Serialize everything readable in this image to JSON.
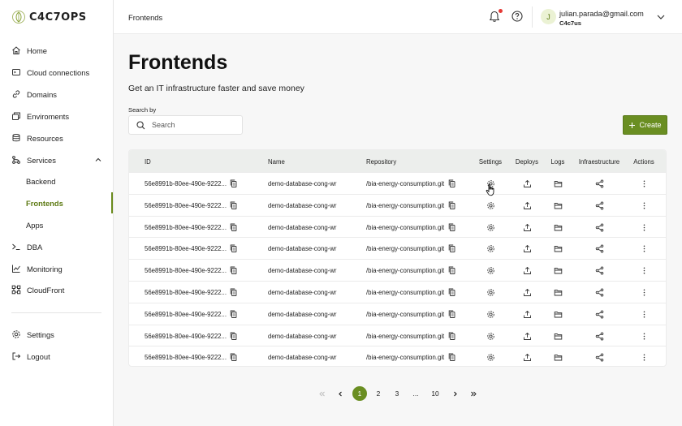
{
  "app": {
    "logo_text": "C4C7OPS"
  },
  "sidebar": {
    "items": [
      {
        "label": "Home",
        "icon": "home-icon"
      },
      {
        "label": "Cloud connections",
        "icon": "cloud-connection-icon"
      },
      {
        "label": "Domains",
        "icon": "link-icon"
      },
      {
        "label": "Enviroments",
        "icon": "environments-icon"
      },
      {
        "label": "Resources",
        "icon": "database-icon"
      },
      {
        "label": "Services",
        "icon": "services-icon",
        "expanded": true
      },
      {
        "label": "Backend",
        "sub": true
      },
      {
        "label": "Frontends",
        "sub": true,
        "active": true
      },
      {
        "label": "Apps",
        "sub": true
      },
      {
        "label": "DBA",
        "icon": "terminal-icon"
      },
      {
        "label": "Monitoring",
        "icon": "chart-icon"
      },
      {
        "label": "CloudFront",
        "icon": "cloudfront-icon"
      }
    ],
    "bottom": [
      {
        "label": "Settings",
        "icon": "gear-icon"
      },
      {
        "label": "Logout",
        "icon": "logout-icon"
      }
    ]
  },
  "topbar": {
    "breadcrumb": "Frontends",
    "user": {
      "initial": "J",
      "email": "julian.parada@gmail.com",
      "org": "C4c7us"
    }
  },
  "page": {
    "title": "Frontends",
    "subtitle": "Get an IT infrastructure faster and save money",
    "search_label": "Search by",
    "search_placeholder": "Search",
    "create_label": "Create"
  },
  "table": {
    "headers": [
      "ID",
      "Name",
      "Repository",
      "Settings",
      "Deploys",
      "Logs",
      "Infraestructure",
      "Actions"
    ],
    "rows": [
      {
        "id": "56e8991b-80ee-490e-9222...",
        "name": "demo-database-cong-wr",
        "repo": "/bia-energy-consumption.git"
      },
      {
        "id": "56e8991b-80ee-490e-9222...",
        "name": "demo-database-cong-wr",
        "repo": "/bia-energy-consumption.git"
      },
      {
        "id": "56e8991b-80ee-490e-9222...",
        "name": "demo-database-cong-wr",
        "repo": "/bia-energy-consumption.git"
      },
      {
        "id": "56e8991b-80ee-490e-9222...",
        "name": "demo-database-cong-wr",
        "repo": "/bia-energy-consumption.git"
      },
      {
        "id": "56e8991b-80ee-490e-9222...",
        "name": "demo-database-cong-wr",
        "repo": "/bia-energy-consumption.git"
      },
      {
        "id": "56e8991b-80ee-490e-9222...",
        "name": "demo-database-cong-wr",
        "repo": "/bia-energy-consumption.git"
      },
      {
        "id": "56e8991b-80ee-490e-9222...",
        "name": "demo-database-cong-wr",
        "repo": "/bia-energy-consumption.git"
      },
      {
        "id": "56e8991b-80ee-490e-9222...",
        "name": "demo-database-cong-wr",
        "repo": "/bia-energy-consumption.git"
      },
      {
        "id": "56e8991b-80ee-490e-9222...",
        "name": "demo-database-cong-wr",
        "repo": "/bia-energy-consumption.git"
      }
    ]
  },
  "pagination": {
    "pages": [
      "1",
      "2",
      "3",
      "...",
      "10"
    ],
    "current": "1"
  },
  "colors": {
    "accent": "#6a8e22",
    "active_text": "#5d7a13",
    "notification": "#e53935"
  }
}
